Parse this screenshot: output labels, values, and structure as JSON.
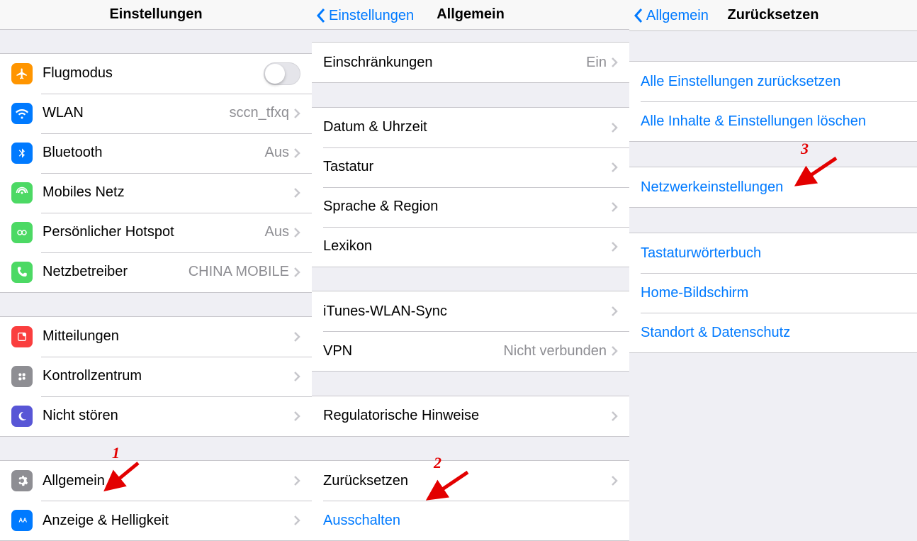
{
  "panel1": {
    "title": "Einstellungen",
    "rows": [
      {
        "label": "Flugmodus",
        "value": "",
        "switch": true,
        "icon": "airplane"
      },
      {
        "label": "WLAN",
        "value": "sccn_tfxq",
        "chev": true,
        "icon": "wifi"
      },
      {
        "label": "Bluetooth",
        "value": "Aus",
        "chev": true,
        "icon": "bluetooth"
      },
      {
        "label": "Mobiles Netz",
        "value": "",
        "chev": true,
        "icon": "cellular"
      },
      {
        "label": "Persönlicher Hotspot",
        "value": "Aus",
        "chev": true,
        "icon": "hotspot"
      },
      {
        "label": "Netzbetreiber",
        "value": "CHINA MOBILE",
        "chev": true,
        "icon": "carrier"
      }
    ],
    "rows2": [
      {
        "label": "Mitteilungen",
        "chev": true,
        "icon": "notifications"
      },
      {
        "label": "Kontrollzentrum",
        "chev": true,
        "icon": "control"
      },
      {
        "label": "Nicht stören",
        "chev": true,
        "icon": "dnd"
      }
    ],
    "rows3": [
      {
        "label": "Allgemein",
        "chev": true,
        "icon": "general"
      },
      {
        "label": "Anzeige & Helligkeit",
        "chev": true,
        "icon": "display"
      }
    ]
  },
  "panel2": {
    "back": "Einstellungen",
    "title": "Allgemein",
    "g1": [
      {
        "label": "Einschränkungen",
        "value": "Ein",
        "chev": true
      }
    ],
    "g2": [
      {
        "label": "Datum & Uhrzeit",
        "chev": true
      },
      {
        "label": "Tastatur",
        "chev": true
      },
      {
        "label": "Sprache & Region",
        "chev": true
      },
      {
        "label": "Lexikon",
        "chev": true
      }
    ],
    "g3": [
      {
        "label": "iTunes-WLAN-Sync",
        "chev": true
      },
      {
        "label": "VPN",
        "value": "Nicht verbunden",
        "chev": true
      }
    ],
    "g4": [
      {
        "label": "Regulatorische Hinweise",
        "chev": true
      }
    ],
    "g5": [
      {
        "label": "Zurücksetzen",
        "chev": true
      },
      {
        "label": "Ausschalten",
        "link": true
      }
    ]
  },
  "panel3": {
    "back": "Allgemein",
    "title": "Zurücksetzen",
    "g1": [
      {
        "label": "Alle Einstellungen zurücksetzen",
        "link": true
      },
      {
        "label": "Alle Inhalte & Einstellungen löschen",
        "link": true
      }
    ],
    "g2": [
      {
        "label": "Netzwerkeinstellungen",
        "link": true
      }
    ],
    "g3": [
      {
        "label": "Tastaturwörterbuch",
        "link": true
      },
      {
        "label": "Home-Bildschirm",
        "link": true
      },
      {
        "label": "Standort & Datenschutz",
        "link": true
      }
    ]
  },
  "step_labels": {
    "s1": "1",
    "s2": "2",
    "s3": "3"
  },
  "icon_colors": {
    "airplane": "#ff9500",
    "wifi": "#007aff",
    "bluetooth": "#007aff",
    "cellular": "#4cd964",
    "hotspot": "#4cd964",
    "carrier": "#4cd964",
    "notifications": "#fa3e3e",
    "control": "#8e8e93",
    "dnd": "#5856d6",
    "general": "#8e8e93",
    "display": "#007aff"
  }
}
